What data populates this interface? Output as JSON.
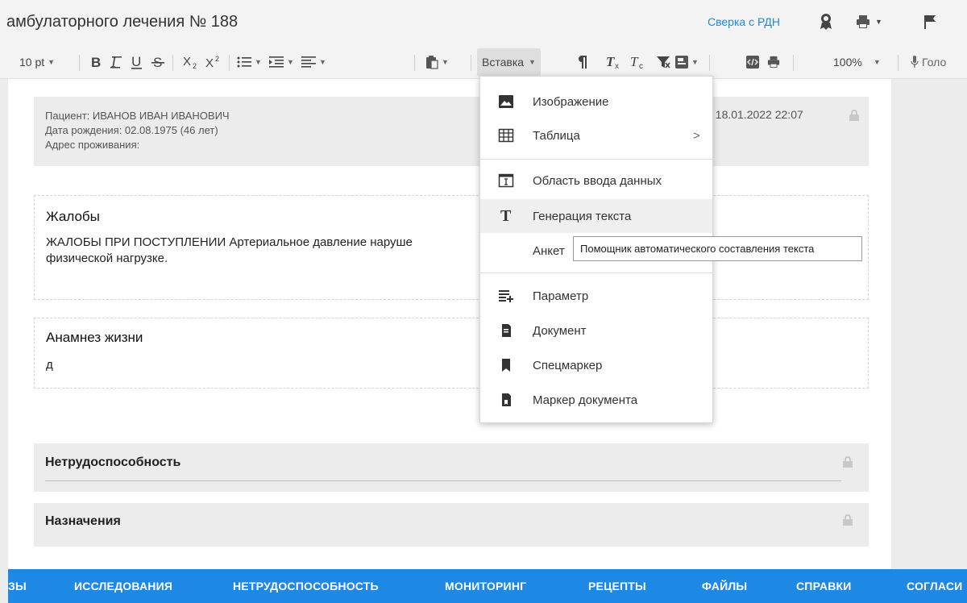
{
  "header": {
    "title": "амбулаторного лечения № 188",
    "rdn_link": "Сверка с РДН"
  },
  "toolbar": {
    "font_size": "10 pt",
    "insert_label": "Вставка",
    "zoom": "100%",
    "voice_label": "Голо"
  },
  "patient": {
    "name_line": "Пациент: ИВАНОВ ИВАН ИВАНОВИЧ",
    "birth_line": "Дата рождения: 02.08.1975 (46 лет)",
    "address_line": "Адрес проживания:",
    "date_fragment": ": 18.01.2022 22:07"
  },
  "sections": {
    "complaints_title": "Жалобы",
    "complaints_line1": "ЖАЛОБЫ ПРИ ПОСТУПЛЕНИИ Артериальное давление наруше",
    "complaints_line2": "физической нагрузке.",
    "anamnesis_title": "Анамнез жизни",
    "anamnesis_text": "д",
    "disability_title": "Нетрудоспособность",
    "prescriptions_title": "Назначения"
  },
  "menu": {
    "items": [
      {
        "label": "Изображение",
        "icon": "image-icon"
      },
      {
        "label": "Таблица",
        "icon": "table-icon",
        "arrow": ">"
      },
      {
        "label": "Область ввода данных",
        "icon": "input-area-icon"
      },
      {
        "label": "Генерация текста",
        "icon": "text-generation-icon"
      },
      {
        "label": "Анкет",
        "icon": ""
      },
      {
        "label": "Параметр",
        "icon": "parameter-icon"
      },
      {
        "label": "Документ",
        "icon": "document-icon"
      },
      {
        "label": "Спецмаркер",
        "icon": "bookmark-icon"
      },
      {
        "label": "Маркер документа",
        "icon": "document-marker-icon"
      }
    ],
    "tooltip": "Помощник автоматического составления текста"
  },
  "tabs": [
    "ЗЫ",
    "ИССЛЕДОВАНИЯ",
    "НЕТРУДОСПОСОБНОСТЬ",
    "МОНИТОРИНГ",
    "РЕЦЕПТЫ",
    "ФАЙЛЫ",
    "СПРАВКИ",
    "СОГЛАСИ"
  ],
  "colors": {
    "accent": "#1e88e5",
    "toolbar_bg": "#f3f3f3",
    "section_bg": "#ececec"
  }
}
